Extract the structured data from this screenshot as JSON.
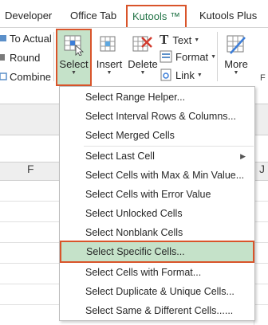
{
  "tabs": [
    "Developer",
    "Office Tab",
    "Kutools ™",
    "Kutools Plus"
  ],
  "active_tab": "Kutools ™",
  "ribbon": {
    "small_commands": [
      "To Actual",
      "Round",
      "Combine"
    ],
    "select_label": "Select",
    "insert_label": "Insert",
    "delete_label": "Delete",
    "text_label": "Text",
    "format_label": "Format",
    "link_label": "Link",
    "more_label": "More",
    "cut_letter": "F"
  },
  "sheet": {
    "columns": [
      "F",
      "J"
    ]
  },
  "menu": {
    "items": [
      "Select Range Helper...",
      "Select Interval Rows & Columns...",
      "Select Merged Cells",
      "Select Last Cell",
      "Select Cells with Max & Min Value...",
      "Select Cells with Error Value",
      "Select Unlocked Cells",
      "Select Nonblank Cells",
      "Select Specific Cells...",
      "Select Cells with Format...",
      "Select Duplicate & Unique Cells...",
      "Select Same & Different Cells......"
    ],
    "highlighted": "Select Specific Cells..."
  },
  "colors": {
    "accent_border": "#d9542a",
    "highlight_fill": "#c5e2c9",
    "tab_green": "#217346"
  }
}
